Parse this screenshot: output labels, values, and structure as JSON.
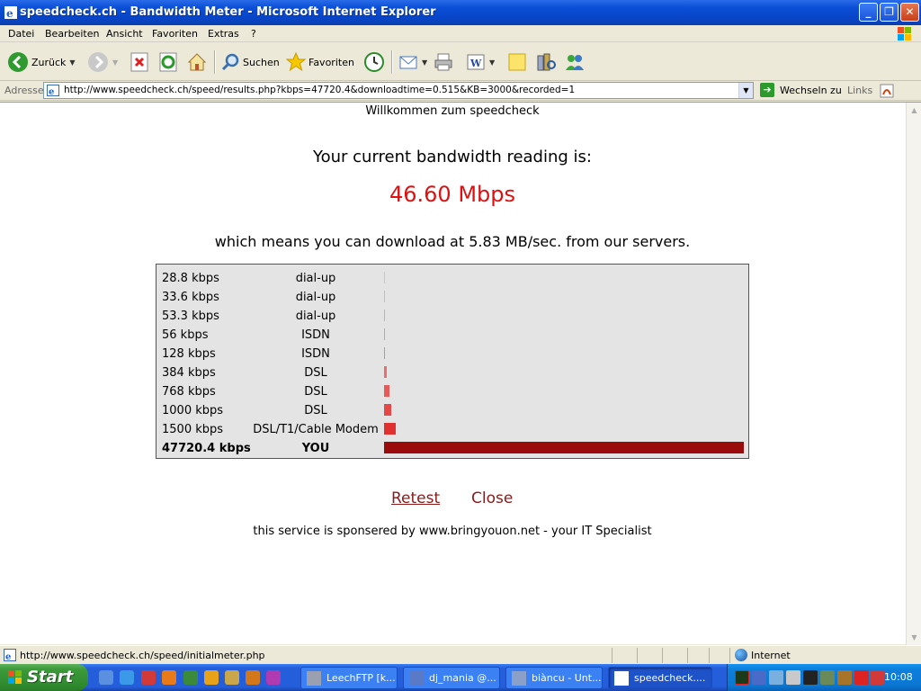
{
  "window": {
    "title": "speedcheck.ch - Bandwidth Meter - Microsoft Internet Explorer",
    "minimize": "_",
    "maximize": "❐",
    "close": "✕"
  },
  "menu": [
    "Datei",
    "Bearbeiten",
    "Ansicht",
    "Favoriten",
    "Extras",
    "?"
  ],
  "toolbar": {
    "back": "Zurück",
    "search": "Suchen",
    "favorites": "Favoriten"
  },
  "address": {
    "label": "Adresse",
    "url": "http://www.speedcheck.ch/speed/results.php?kbps=47720.4&downloadtime=0.515&KB=3000&recorded=1",
    "go": "Wechseln zu",
    "links": "Links"
  },
  "page": {
    "welcome": "Willkommen zum speedcheck",
    "reading_label": "Your current bandwidth reading is:",
    "reading_value": "46.60 Mbps",
    "download_line": "which means you can download at 5.83 MB/sec. from our servers.",
    "retest": "Retest",
    "close": "Close",
    "sponsor": "this service is sponsered by www.bringyouon.net - your IT Specialist"
  },
  "speed_rows": [
    {
      "speed": "28.8 kbps",
      "type": "dial-up",
      "kbps": 28.8,
      "color": "#f7b3b3"
    },
    {
      "speed": "33.6 kbps",
      "type": "dial-up",
      "kbps": 33.6,
      "color": "#f5a8a8"
    },
    {
      "speed": "53.3 kbps",
      "type": "dial-up",
      "kbps": 53.3,
      "color": "#f39c9c"
    },
    {
      "speed": "56 kbps",
      "type": "ISDN",
      "kbps": 56,
      "color": "#f29090"
    },
    {
      "speed": "128 kbps",
      "type": "ISDN",
      "kbps": 128,
      "color": "#ef8080"
    },
    {
      "speed": "384 kbps",
      "type": "DSL",
      "kbps": 384,
      "color": "#ec6b6b"
    },
    {
      "speed": "768 kbps",
      "type": "DSL",
      "kbps": 768,
      "color": "#e85959"
    },
    {
      "speed": "1000 kbps",
      "type": "DSL",
      "kbps": 1000,
      "color": "#e54848"
    },
    {
      "speed": "1500 kbps",
      "type": "DSL/T1/Cable Modem",
      "kbps": 1500,
      "color": "#e03030"
    },
    {
      "speed": "47720.4 kbps",
      "type": "YOU",
      "kbps": 47720.4,
      "color": "#9a0c0c",
      "you": true
    }
  ],
  "status": {
    "url": "http://www.speedcheck.ch/speed/initialmeter.php",
    "zone": "Internet"
  },
  "taskbar": {
    "start": "Start",
    "tasks": [
      {
        "label": "LeechFTP [k...",
        "active": false
      },
      {
        "label": "dj_mania @...",
        "active": false
      },
      {
        "label": "biàncu - Unt...",
        "active": false
      },
      {
        "label": "speedcheck....",
        "active": true
      }
    ],
    "clock": "10:08"
  }
}
